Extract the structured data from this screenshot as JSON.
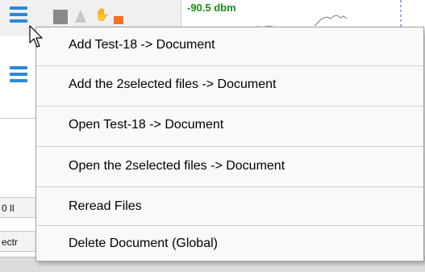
{
  "toolbar": {
    "signal_readout": "-90.5 dbm",
    "icons": [
      "hamburger-menu-icon",
      "stop-icon",
      "triangle-icon",
      "hand-icon",
      "orange-marker-icon"
    ],
    "accent": "#2b8ad6",
    "signal_color": "#1a8a1a",
    "marker_color": "#f37021"
  },
  "left_panel": {
    "cell1": "0 lI",
    "cell2": "ectr"
  },
  "context_menu": {
    "items": [
      {
        "label": "Add Test-18 -> Document"
      },
      {
        "label": "Add the 2selected files -> Document"
      },
      {
        "label": "Open Test-18 -> Document"
      },
      {
        "label": "Open the 2selected files -> Document"
      },
      {
        "label": "Reread Files"
      },
      {
        "label": "Delete Document (Global)"
      }
    ]
  }
}
